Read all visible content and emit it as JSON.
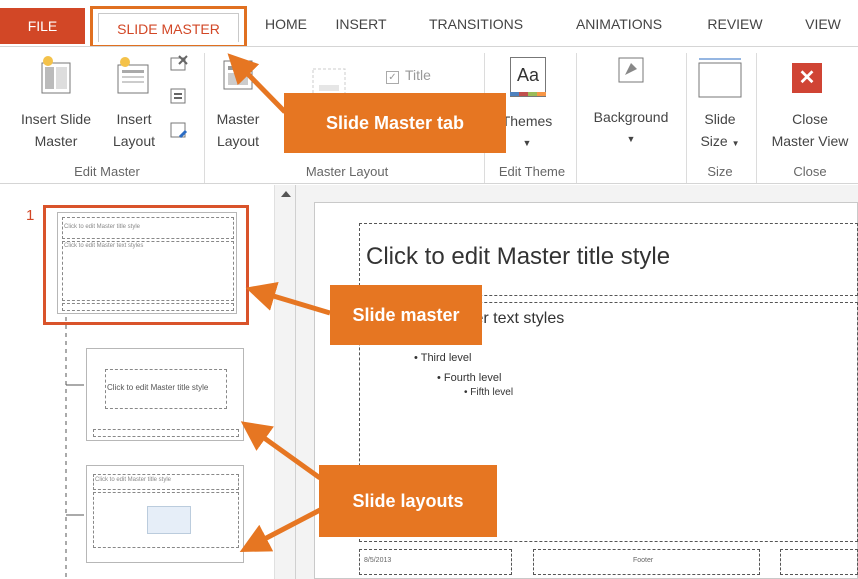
{
  "tabs": {
    "file": "FILE",
    "slide_master": "SLIDE MASTER",
    "home": "HOME",
    "insert": "INSERT",
    "transitions": "TRANSITIONS",
    "animations": "ANIMATIONS",
    "review": "REVIEW",
    "view": "VIEW"
  },
  "ribbon": {
    "edit_master": {
      "label": "Edit Master",
      "insert_slide_master": [
        "Insert Slide",
        "Master"
      ],
      "insert_layout": [
        "Insert",
        "Layout"
      ]
    },
    "master_layout": {
      "label": "Master Layout",
      "master_layout_btn": [
        "Master",
        "Layout"
      ],
      "title_checkbox": "Title"
    },
    "edit_theme": {
      "label": "Edit Theme",
      "themes": "Themes",
      "themes_glyph": "Aa"
    },
    "background": {
      "label": "Background"
    },
    "size": {
      "label": "Size",
      "slide_size": [
        "Slide",
        "Size"
      ]
    },
    "close": {
      "label": "Close",
      "close_master_view": [
        "Close",
        "Master View"
      ]
    }
  },
  "thumbnails": {
    "slide_number": "1",
    "master_title": "Click to edit Master title style",
    "master_text": "Click to edit Master text styles",
    "layout1_title": "Click to edit Master title style",
    "layout2_title": "Click to edit Master title style"
  },
  "slide": {
    "title": "Click to edit Master title style",
    "text_fragment": "ter text styles",
    "third_level": "Third level",
    "fourth_level": "Fourth level",
    "fifth_level": "Fifth level",
    "date": "8/5/2013",
    "footer": "Footer"
  },
  "callouts": {
    "slide_master_tab": "Slide Master tab",
    "slide_master": "Slide master",
    "slide_layouts": "Slide layouts"
  },
  "colors": {
    "file_tab": "#d24726",
    "callout": "#e67622",
    "highlight_border": "#d9532a",
    "close_icon": "#d04434"
  }
}
